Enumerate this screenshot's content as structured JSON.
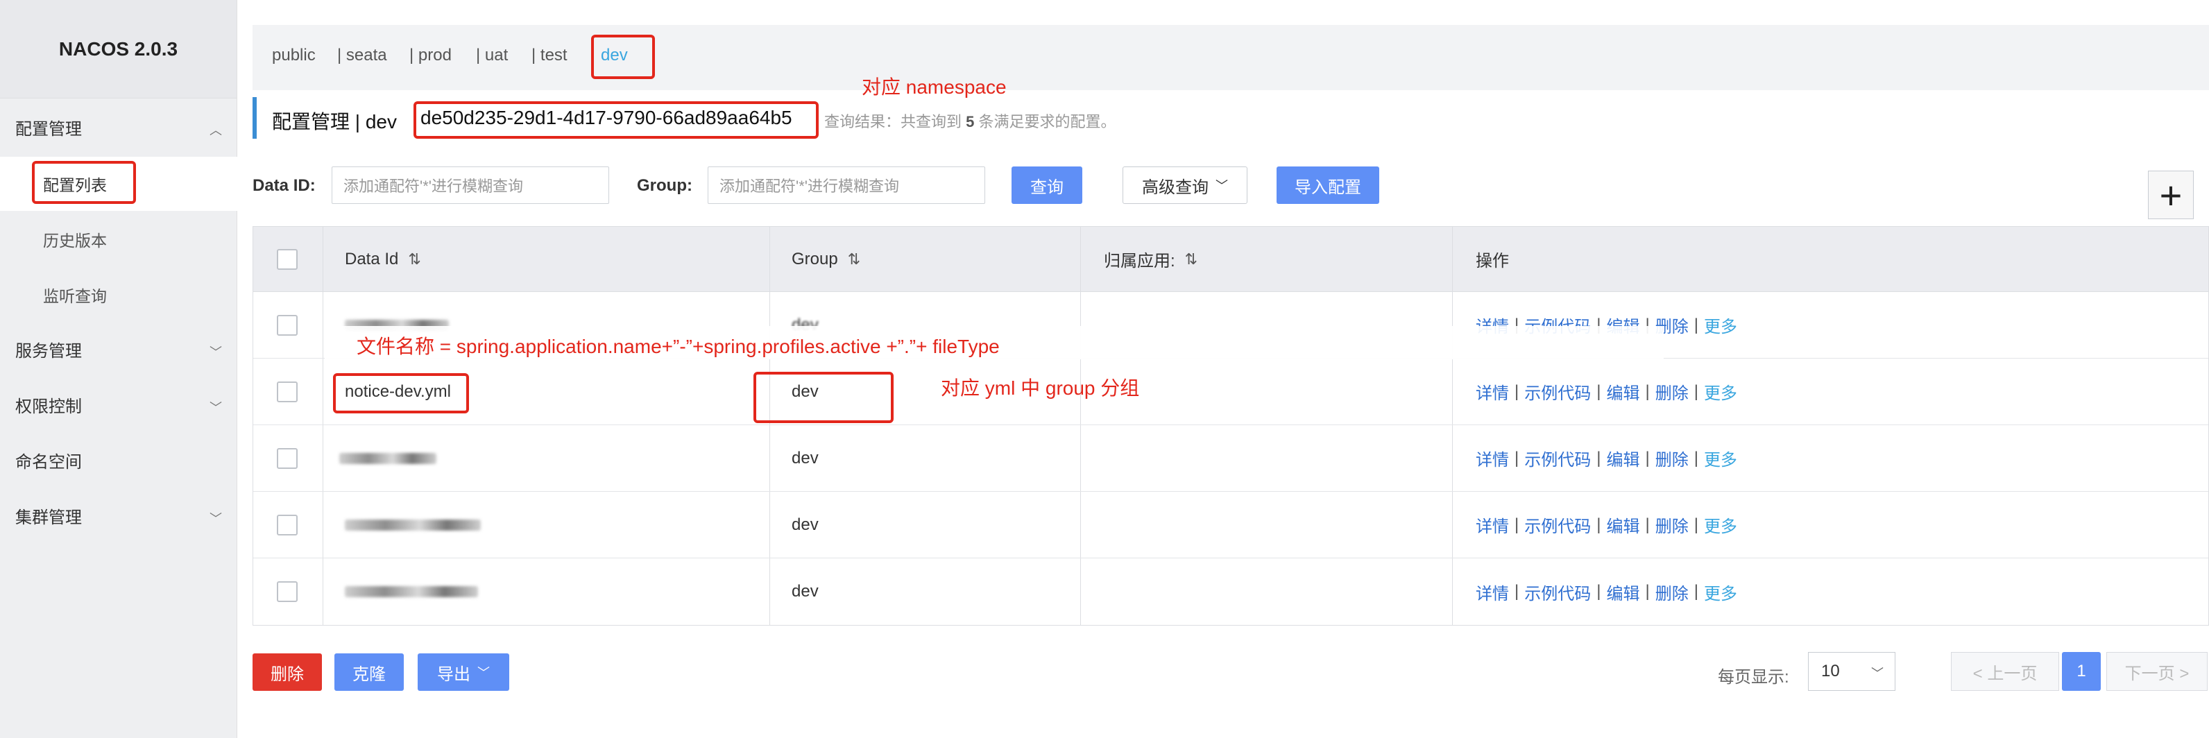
{
  "brand": {
    "title": "NACOS 2.0.3"
  },
  "sidebar": {
    "config_mgmt": "配置管理",
    "config_list": "配置列表",
    "history": "历史版本",
    "listen_query": "监听查询",
    "service_mgmt": "服务管理",
    "access_control": "权限控制",
    "namespace": "命名空间",
    "cluster_mgmt": "集群管理"
  },
  "namespaces": {
    "public": "public",
    "seata": "| seata",
    "prod": "| prod",
    "uat": "| uat",
    "test": "| test",
    "dev": "dev"
  },
  "header": {
    "title": "配置管理 | dev",
    "namespace_id": "de50d235-29d1-4d17-9790-66ad89aa64b5",
    "result_prefix": "查询结果：共查询到",
    "result_count": "5",
    "result_suffix": "条满足要求的配置。"
  },
  "filters": {
    "data_id_label": "Data ID:",
    "data_id_placeholder": "添加通配符'*'进行模糊查询",
    "group_label": "Group:",
    "group_placeholder": "添加通配符'*'进行模糊查询",
    "query_btn": "查询",
    "advanced_btn": "高级查询",
    "import_btn": "导入配置",
    "add_btn": "+"
  },
  "table": {
    "headers": {
      "data_id": "Data Id",
      "group": "Group",
      "app": "归属应用:",
      "ops": "操作"
    },
    "rows": [
      {
        "group": "dev"
      },
      {
        "data_id": "notice-dev.yml",
        "group": "dev"
      },
      {
        "group": "dev"
      },
      {
        "group": "dev"
      },
      {
        "group": "dev"
      }
    ],
    "ops": {
      "detail": "详情",
      "sample": "示例代码",
      "edit": "编辑",
      "delete": "删除",
      "more": "更多",
      "sep": "|"
    }
  },
  "footer": {
    "delete_btn": "删除",
    "clone_btn": "克隆",
    "export_btn": "导出",
    "page_size_label": "每页显示:",
    "page_size": "10",
    "prev": "< 上一页",
    "page": "1",
    "next": "下一页 >"
  },
  "annotations": {
    "namespace_note": "对应 namespace",
    "filename_note": "文件名称 = spring.application.name+”-”+spring.profiles.active +”.”+ fileType",
    "group_note": "对应 yml 中 group 分组"
  },
  "colors": {
    "accent": "#5f8ff6",
    "danger": "#e2362b",
    "link": "#2f6fd1",
    "active_ns": "#39a6df",
    "annotation": "#e3261b"
  }
}
